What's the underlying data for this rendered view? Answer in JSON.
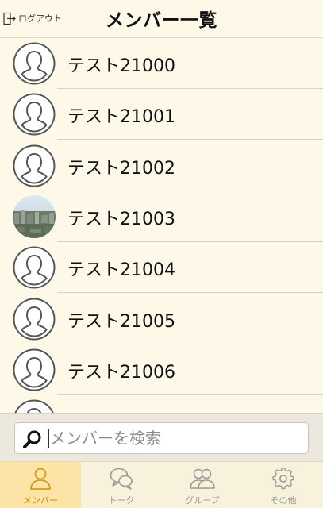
{
  "header": {
    "logout_label": "ログアウト",
    "title": "メンバー一覧"
  },
  "members": [
    {
      "name": "テスト21000",
      "avatar": "default-person-icon"
    },
    {
      "name": "テスト21001",
      "avatar": "default-person-icon"
    },
    {
      "name": "テスト21002",
      "avatar": "default-person-icon"
    },
    {
      "name": "テスト21003",
      "avatar": "city-photo"
    },
    {
      "name": "テスト21004",
      "avatar": "default-person-icon"
    },
    {
      "name": "テスト21005",
      "avatar": "default-person-icon"
    },
    {
      "name": "テスト21006",
      "avatar": "default-person-icon"
    },
    {
      "name": "",
      "avatar": "default-person-icon"
    }
  ],
  "search": {
    "placeholder": "メンバーを検索",
    "icon": "search-icon"
  },
  "tabs": [
    {
      "label": "メンバー",
      "icon": "person-icon",
      "active": true
    },
    {
      "label": "トーク",
      "icon": "chat-bubbles-icon",
      "active": false
    },
    {
      "label": "グループ",
      "icon": "group-icon",
      "active": false
    },
    {
      "label": "その他",
      "icon": "gear-icon",
      "active": false
    }
  ],
  "colors": {
    "background": "#fdf8e8",
    "active_tab": "#fce4a6",
    "active_tab_text": "#cc8a00",
    "inactive_tab_text": "#999999"
  }
}
